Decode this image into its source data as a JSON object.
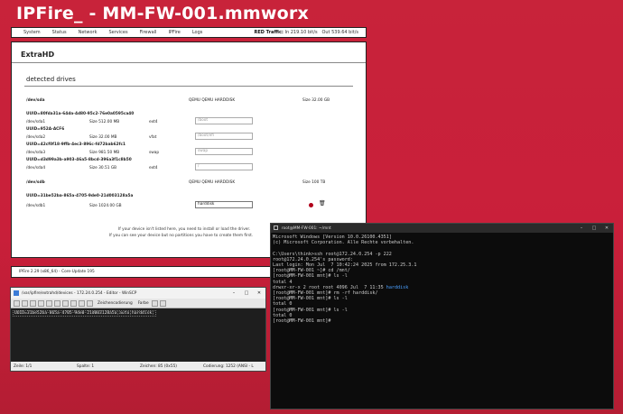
{
  "header": {
    "title": "IPFire_ - MM-FW-001.mmworx"
  },
  "nav": {
    "items": [
      "System",
      "Status",
      "Network",
      "Services",
      "Firewall",
      "IPFire",
      "Logs"
    ],
    "traffic_label": "RED Traffic:",
    "traffic_in": "In 219.10 bit/s",
    "traffic_out": "Out 539.64 bit/s"
  },
  "panel": {
    "title": "ExtraHD",
    "section_title": "detected drives",
    "drives": [
      {
        "device": "/dev/sda",
        "model": "QEMU QEMU HARDDISK",
        "size": "Size 32.00 GB",
        "partitions": [
          {
            "uuid": "UUID=80fda31a-64da-4d80-95c2-76e0a0595ca40",
            "dev": "/dev/sda1",
            "size": "Size 512.00 MB",
            "fs": "ext4",
            "mount": "/boot"
          },
          {
            "uuid": "UUID=952A-ACF6",
            "dev": "/dev/sda2",
            "size": "Size 32.00 MB",
            "fs": "vfat",
            "mount": "/boot/efi"
          },
          {
            "uuid": "UUID=42cf0f18-9ffb-4ec3-896c-fd72bab62fc1",
            "dev": "/dev/sda3",
            "size": "Size 981.50 MB",
            "fs": "swap",
            "mount": "swap"
          },
          {
            "uuid": "UUID=d3d99a3b-a903-46a5-8bcd-396a3f1c8b50",
            "dev": "/dev/sda4",
            "size": "Size 30.51 GB",
            "fs": "ext4",
            "mount": "/"
          }
        ]
      },
      {
        "device": "/dev/sdb",
        "model": "QEMU QEMU HARDDISK",
        "size": "Size 100 TB",
        "partitions": [
          {
            "uuid": "UUID=31be52ba-865a-4705-9de0-21d003128a5a",
            "dev": "/dev/sdb1",
            "size": "Size 1024.00 GB",
            "fs": "",
            "mount": "harddisk"
          }
        ]
      }
    ],
    "note_line1": "If your device isn't listed here, you need to install or load the driver.",
    "note_line2": "If you can see your device but no partitions you have to create them first."
  },
  "statusbar": {
    "left": "IPFire 2.29 (x86_64) - Core-Update 195",
    "right": "IPFire.org - Sup"
  },
  "editor": {
    "title": "/var/ipfire/extrahd/devices - 172.24.0.254 - Editor - WinSCP",
    "encoding_label": "Zeichencodierung",
    "color_label": "Farbe",
    "content": "UUID=31be52ba-865a-4705-9de0-21d003128a5a;auto;harddisk;",
    "status_line": "Zeile: 1/1",
    "status_col": "Spalte: 1",
    "status_chars": "Zeichen: 85 (0x55)",
    "status_enc": "Codierung: 1252  (ANSI - L"
  },
  "terminal": {
    "title": "root@MM-FW-001: ~/mnt",
    "lines": [
      "Microsoft Windows [Version 10.0.26100.4351]",
      "(c) Microsoft Corporation. Alle Rechte vorbehalten.",
      "",
      "C:\\Users\\think>ssh root@172.24.0.254 -p 222",
      "root@172.24.0.254's password:",
      "Last login: Mon Jul  7 10:42:24 2025 from 172.25.3.1",
      "[root@MM-FW-001 ~]# cd /mnt/",
      "[root@MM-FW-001 mnt]# ls -l",
      "total 4",
      "drwxr-xr-x 2 root root 4096 Jul  7 11:35 ",
      "[root@MM-FW-001 mnt]# rm -rf harddisk/",
      "[root@MM-FW-001 mnt]# ls -l",
      "total 0",
      "[root@MM-FW-001 mnt]# ls -l",
      "total 0",
      "[root@MM-FW-001 mnt]# "
    ],
    "highlight": "harddisk"
  }
}
